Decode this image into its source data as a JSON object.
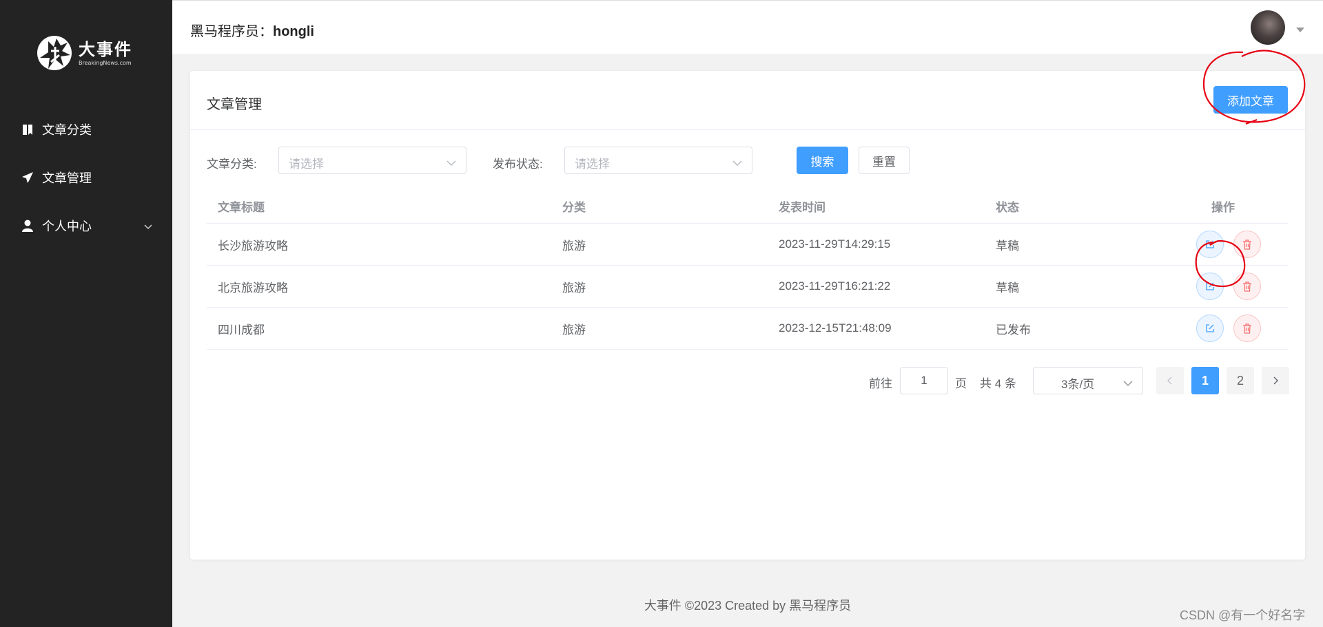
{
  "sidebar": {
    "logo_title": "大事件",
    "logo_sub": "BreakingNews.com",
    "items": [
      {
        "label": "文章分类",
        "icon": "book-icon"
      },
      {
        "label": "文章管理",
        "icon": "paper-plane-icon"
      },
      {
        "label": "个人中心",
        "icon": "user-icon"
      }
    ]
  },
  "header": {
    "user_prefix": "黑马程序员：",
    "user_name": "hongli"
  },
  "card": {
    "title": "文章管理",
    "add_button": "添加文章"
  },
  "filters": {
    "category_label": "文章分类:",
    "category_placeholder": "请选择",
    "state_label": "发布状态:",
    "state_placeholder": "请选择",
    "search_button": "搜索",
    "reset_button": "重置"
  },
  "table": {
    "columns": [
      "文章标题",
      "分类",
      "发表时间",
      "状态",
      "操作"
    ],
    "rows": [
      {
        "title": "长沙旅游攻略",
        "category": "旅游",
        "time": "2023-11-29T14:29:15",
        "state": "草稿"
      },
      {
        "title": "北京旅游攻略",
        "category": "旅游",
        "time": "2023-11-29T16:21:22",
        "state": "草稿"
      },
      {
        "title": "四川成都",
        "category": "旅游",
        "time": "2023-12-15T21:48:09",
        "state": "已发布"
      }
    ]
  },
  "pagination": {
    "goto_label": "前往",
    "current_input": "1",
    "page_unit": "页",
    "total_text": "共 4 条",
    "page_size": "3条/页",
    "pages": [
      "1",
      "2"
    ],
    "active_page": "1"
  },
  "footer": "大事件 ©2023 Created by 黑马程序员",
  "watermark": "CSDN @有一个好名字",
  "colors": {
    "primary": "#409eff",
    "sidebar_bg": "#232323",
    "danger": "#f56c6c",
    "annotation": "#e60012"
  }
}
